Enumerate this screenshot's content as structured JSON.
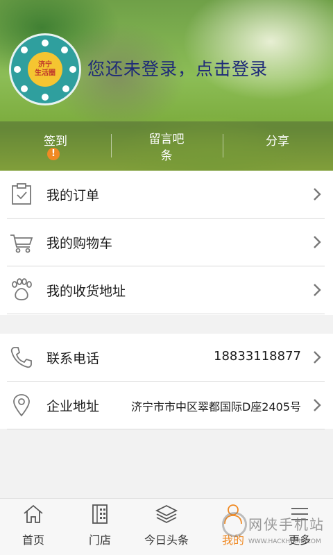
{
  "profile": {
    "logo_text_line1": "济宁",
    "logo_text_line2": "生活圈",
    "login_prompt": "您还未登录，点击登录"
  },
  "actions": {
    "checkin_label": "签到",
    "checkin_badge": "!",
    "message_label": "留言吧条",
    "share_label": "分享"
  },
  "menu": {
    "orders_label": "我的订单",
    "cart_label": "我的购物车",
    "address_label": "我的收货地址"
  },
  "contact": {
    "phone_label": "联系电话",
    "phone_value": "18833118877",
    "company_address_label": "企业地址",
    "company_address_value": "济宁市市中区翠都国际D座2405号"
  },
  "bottom_nav": {
    "home_label": "首页",
    "store_label": "门店",
    "headlines_label": "今日头条",
    "mine_label": "我的",
    "more_label": "更多"
  },
  "watermark": {
    "title": "网侠手机站",
    "url": "WWW.HACKHOME.COM"
  },
  "colors": {
    "accent": "#f08a24",
    "login_text": "#1e2a78",
    "logo_bg": "#2f9f9e"
  }
}
